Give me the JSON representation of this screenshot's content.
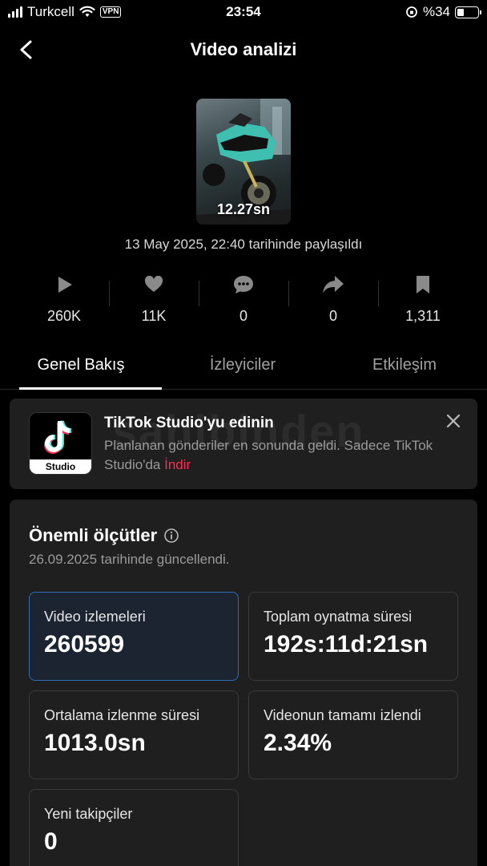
{
  "status_bar": {
    "carrier": "Turkcell",
    "vpn": "VPN",
    "time": "23:54",
    "battery": "%34",
    "battery_level": 0.34
  },
  "header": {
    "title": "Video analizi"
  },
  "video": {
    "duration": "12.27sn",
    "posted": "13 May 2025, 22:40 tarihinde paylaşıldı"
  },
  "stats": [
    {
      "icon": "play-icon",
      "value": "260K"
    },
    {
      "icon": "heart-icon",
      "value": "11K"
    },
    {
      "icon": "comment-icon",
      "value": "0"
    },
    {
      "icon": "share-icon",
      "value": "0"
    },
    {
      "icon": "bookmark-icon",
      "value": "1,311"
    }
  ],
  "tabs": [
    {
      "label": "Genel Bakış",
      "active": true
    },
    {
      "label": "İzleyiciler",
      "active": false
    },
    {
      "label": "Etkileşim",
      "active": false
    }
  ],
  "promo": {
    "logo_label": "Studio",
    "title": "TikTok Studio'yu edinin",
    "desc": "Planlanan gönderiler en sonunda geldi. Sadece TikTok Studio'da ",
    "link": "İndir"
  },
  "metrics": {
    "title": "Önemli ölçütler",
    "updated": "26.09.2025 tarihinde güncellendi.",
    "cards": [
      {
        "label": "Video izlemeleri",
        "value": "260599"
      },
      {
        "label": "Toplam oynatma süresi",
        "value": "192s:11d:21sn"
      },
      {
        "label": "Ortalama izlenme süresi",
        "value": "1013.0sn"
      },
      {
        "label": "Videonun tamamı izlendi",
        "value": "2.34%"
      },
      {
        "label": "Yeni takipçiler",
        "value": "0"
      }
    ]
  },
  "watermark": "sahibinden",
  "colors": {
    "accent_link": "#fe2c55",
    "selected_border": "#2a6fb8",
    "card_bg": "#1f1f1f"
  }
}
